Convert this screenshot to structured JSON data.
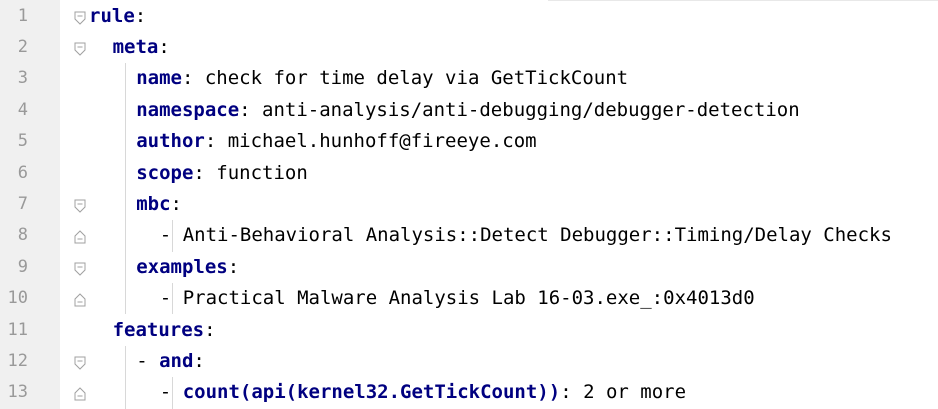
{
  "lines": [
    {
      "num": "1",
      "indent": 0,
      "dash": "",
      "key": "rule",
      "sep": ":",
      "value": "",
      "fold": "open"
    },
    {
      "num": "2",
      "indent": 2,
      "dash": "",
      "key": "meta",
      "sep": ":",
      "value": "",
      "fold": "open"
    },
    {
      "num": "3",
      "indent": 4,
      "dash": "",
      "key": "name",
      "sep": ": ",
      "value": "check for time delay via GetTickCount",
      "fold": ""
    },
    {
      "num": "4",
      "indent": 4,
      "dash": "",
      "key": "namespace",
      "sep": ": ",
      "value": "anti-analysis/anti-debugging/debugger-detection",
      "fold": ""
    },
    {
      "num": "5",
      "indent": 4,
      "dash": "",
      "key": "author",
      "sep": ": ",
      "value": "michael.hunhoff@fireeye.com",
      "fold": ""
    },
    {
      "num": "6",
      "indent": 4,
      "dash": "",
      "key": "scope",
      "sep": ": ",
      "value": "function",
      "fold": ""
    },
    {
      "num": "7",
      "indent": 4,
      "dash": "",
      "key": "mbc",
      "sep": ":",
      "value": "",
      "fold": "open"
    },
    {
      "num": "8",
      "indent": 6,
      "dash": "- ",
      "key": "",
      "sep": "",
      "value": "Anti-Behavioral Analysis::Detect Debugger::Timing/Delay Checks",
      "fold": "close"
    },
    {
      "num": "9",
      "indent": 4,
      "dash": "",
      "key": "examples",
      "sep": ":",
      "value": "",
      "fold": "open"
    },
    {
      "num": "10",
      "indent": 6,
      "dash": "- ",
      "key": "",
      "sep": "",
      "value": "Practical Malware Analysis Lab 16-03.exe_:0x4013d0",
      "fold": "close"
    },
    {
      "num": "11",
      "indent": 2,
      "dash": "",
      "key": "features",
      "sep": ":",
      "value": "",
      "fold": ""
    },
    {
      "num": "12",
      "indent": 4,
      "dash": "- ",
      "key": "and",
      "sep": ":",
      "value": "",
      "fold": "open"
    },
    {
      "num": "13",
      "indent": 6,
      "dash": "- ",
      "key": "count(api(kernel32.GetTickCount))",
      "sep": ": ",
      "value": "2 or more",
      "fold": "close"
    }
  ],
  "colors": {
    "gutter_bg": "#f0f0f0",
    "line_number": "#999999",
    "key": "#000080",
    "text": "#000000",
    "fold_marker": "#a0a0a0",
    "indent_guide": "#d8d8d8"
  }
}
